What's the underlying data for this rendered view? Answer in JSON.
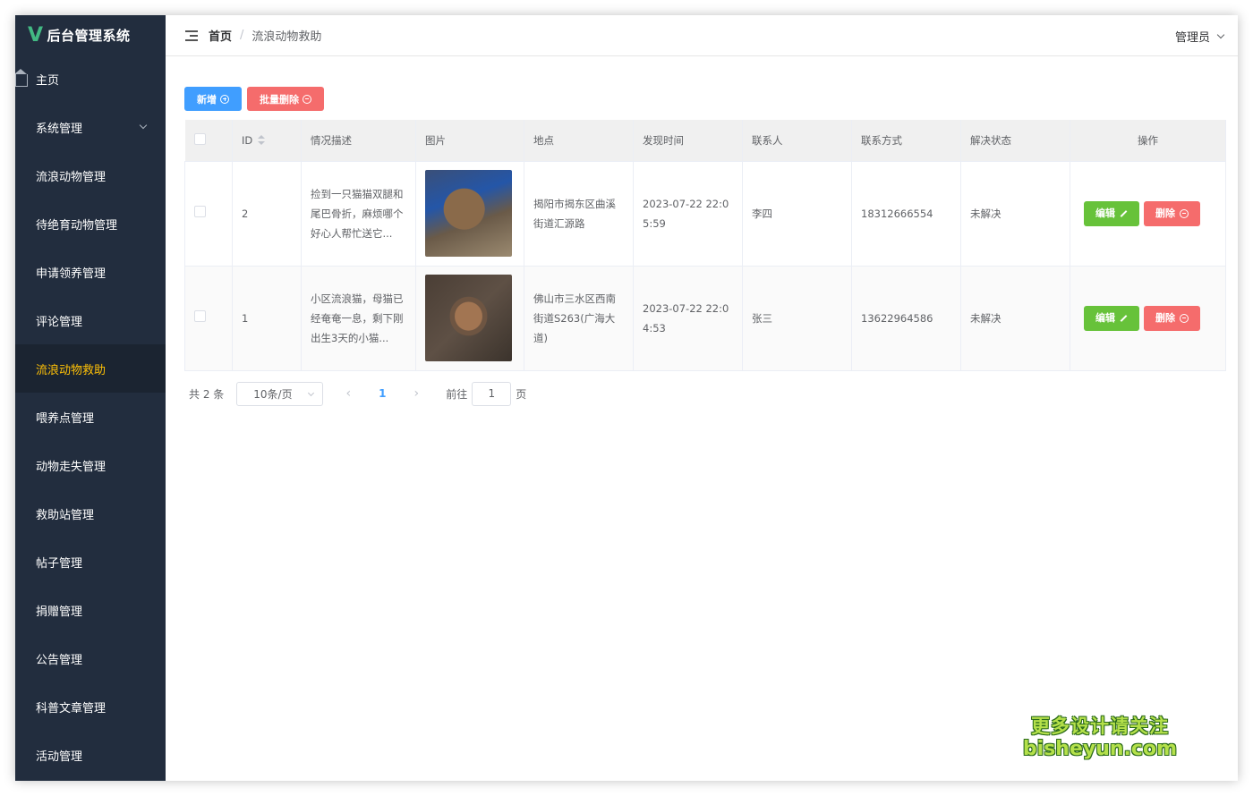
{
  "app": {
    "title": "后台管理系统",
    "logo_letter": "V"
  },
  "sidebar": {
    "items": [
      {
        "label": "主页",
        "icon": "home-icon"
      },
      {
        "label": "系统管理",
        "icon": "grid-icon",
        "expandable": true
      },
      {
        "label": "流浪动物管理",
        "icon": "grid-icon"
      },
      {
        "label": "待绝育动物管理",
        "icon": "grid-icon"
      },
      {
        "label": "申请领养管理",
        "icon": "grid-icon"
      },
      {
        "label": "评论管理",
        "icon": "grid-icon"
      },
      {
        "label": "流浪动物救助",
        "icon": "grid-icon",
        "active": true
      },
      {
        "label": "喂养点管理",
        "icon": "grid-icon"
      },
      {
        "label": "动物走失管理",
        "icon": "grid-icon"
      },
      {
        "label": "救助站管理",
        "icon": "grid-icon"
      },
      {
        "label": "帖子管理",
        "icon": "grid-icon"
      },
      {
        "label": "捐赠管理",
        "icon": "grid-icon"
      },
      {
        "label": "公告管理",
        "icon": "grid-icon"
      },
      {
        "label": "科普文章管理",
        "icon": "grid-icon"
      },
      {
        "label": "活动管理",
        "icon": "grid-icon"
      }
    ],
    "active_color": "#ffc107",
    "bg_color": "#222d3e"
  },
  "header": {
    "breadcrumb": {
      "home": "首页",
      "separator": "/",
      "current": "流浪动物救助"
    },
    "user": "管理员"
  },
  "toolbar": {
    "add_label": "新增",
    "batch_delete_label": "批量删除"
  },
  "table": {
    "columns": [
      "ID",
      "情况描述",
      "图片",
      "地点",
      "发现时间",
      "联系人",
      "联系方式",
      "解决状态",
      "操作"
    ],
    "rows": [
      {
        "id": "2",
        "desc": "捡到一只猫猫双腿和尾巴骨折，麻烦哪个好心人帮忙送它...",
        "location": "揭阳市揭东区曲溪街道汇源路",
        "time": "2023-07-22 22:05:59",
        "contact": "李四",
        "phone": "18312666554",
        "status": "未解决"
      },
      {
        "id": "1",
        "desc": "小区流浪猫，母猫已经奄奄一息，剩下刚出生3天的小猫...",
        "location": "佛山市三水区西南街道S263(广海大道)",
        "time": "2023-07-22 22:04:53",
        "contact": "张三",
        "phone": "13622964586",
        "status": "未解决"
      }
    ],
    "edit_label": "编辑",
    "delete_label": "删除"
  },
  "pagination": {
    "total_text": "共 2 条",
    "page_size": "10条/页",
    "current_page": "1",
    "goto_label": "前往",
    "goto_value": "1",
    "page_suffix": "页"
  },
  "watermark": {
    "line1": "更多设计请关注",
    "line2": "bisheyun.com"
  },
  "colors": {
    "primary": "#409eff",
    "danger": "#f56c6c",
    "success": "#67c23a"
  }
}
